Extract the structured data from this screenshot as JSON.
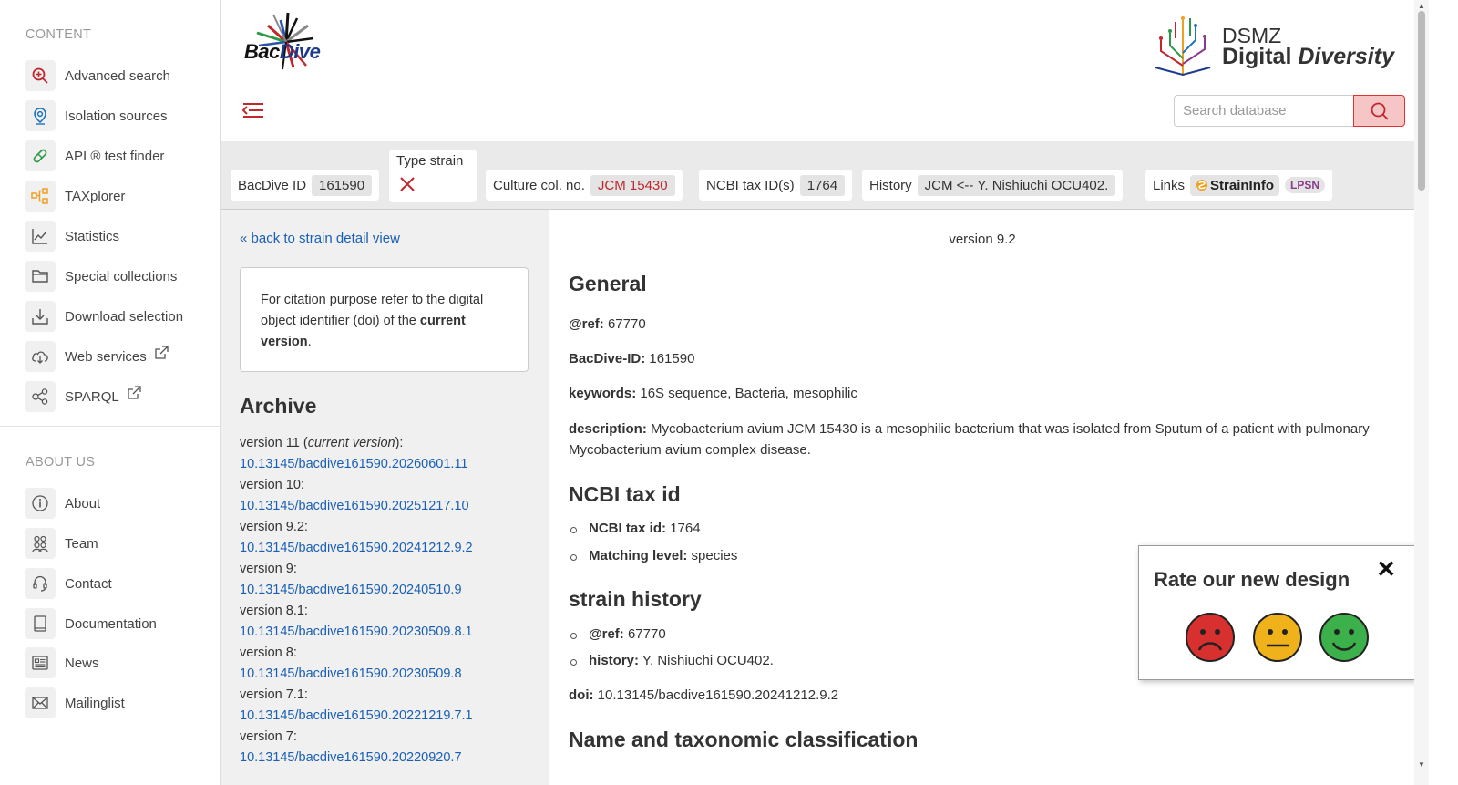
{
  "sidebar": {
    "content_heading": "CONTENT",
    "content_items": [
      {
        "label": "Advanced search",
        "icon": "search-plus-icon"
      },
      {
        "label": "Isolation sources",
        "icon": "location-pin-icon"
      },
      {
        "label": "API ® test finder",
        "icon": "pill-icon"
      },
      {
        "label": "TAXplorer",
        "icon": "tree-icon"
      },
      {
        "label": "Statistics",
        "icon": "chart-line-icon"
      },
      {
        "label": "Special collections",
        "icon": "folder-icon"
      },
      {
        "label": "Download selection",
        "icon": "download-icon"
      },
      {
        "label": "Web services",
        "icon": "cloud-download-icon"
      },
      {
        "label": "SPARQL",
        "icon": "share-nodes-icon"
      }
    ],
    "about_heading": "ABOUT US",
    "about_items": [
      {
        "label": "About",
        "icon": "info-icon"
      },
      {
        "label": "Team",
        "icon": "team-icon"
      },
      {
        "label": "Contact",
        "icon": "headset-icon"
      },
      {
        "label": "Documentation",
        "icon": "book-icon"
      },
      {
        "label": "News",
        "icon": "newspaper-icon"
      },
      {
        "label": "Mailinglist",
        "icon": "envelope-icon"
      }
    ]
  },
  "header": {
    "logo_bac": "Bac",
    "logo_dive": "Dive",
    "dsmz_title": "DSMZ",
    "dsmz_sub_1": "Digital",
    "dsmz_sub_2": "Diversity",
    "search_placeholder": "Search database"
  },
  "infobar": {
    "bacdive_id_label": "BacDive ID",
    "bacdive_id_value": "161590",
    "type_strain_label": "Type strain",
    "culture_label": "Culture col. no.",
    "culture_value": "JCM 15430",
    "ncbi_label": "NCBI tax ID(s)",
    "ncbi_value": "1764",
    "history_label": "History",
    "history_value": "JCM <-- Y. Nishiuchi OCU402.",
    "links_label": "Links",
    "straininfo": "StrainInfo",
    "lpsn": "LPSN"
  },
  "left": {
    "back_link": "« back to strain detail view",
    "cite_1": "For citation purpose refer to the digital object identifier (doi) of the ",
    "cite_bold": "current version",
    "cite_end": ".",
    "archive_title": "Archive",
    "archive": [
      {
        "version": "version 11 (",
        "current": "current version",
        "suffix": "):",
        "doi": "10.13145/bacdive161590.20260601.11"
      },
      {
        "version": "version 10:",
        "doi": "10.13145/bacdive161590.20251217.10"
      },
      {
        "version": "version 9.2:",
        "doi": "10.13145/bacdive161590.20241212.9.2"
      },
      {
        "version": "version 9:",
        "doi": "10.13145/bacdive161590.20240510.9"
      },
      {
        "version": "version 8.1:",
        "doi": "10.13145/bacdive161590.20230509.8.1"
      },
      {
        "version": "version 8:",
        "doi": "10.13145/bacdive161590.20230509.8"
      },
      {
        "version": "version 7.1:",
        "doi": "10.13145/bacdive161590.20221219.7.1"
      },
      {
        "version": "version 7:",
        "doi": "10.13145/bacdive161590.20220920.7"
      }
    ]
  },
  "main": {
    "version": "version 9.2",
    "general_title": "General",
    "ref_label": "@ref:",
    "ref_value": "67770",
    "bacdive_label": "BacDive-ID:",
    "bacdive_value": "161590",
    "keywords_label": "keywords:",
    "keywords_value": "16S sequence, Bacteria, mesophilic",
    "description_label": "description:",
    "description_value": "Mycobacterium avium JCM 15430 is a mesophilic bacterium that was isolated from Sputum of a patient with pulmonary Mycobacterium avium complex disease.",
    "ncbi_title": "NCBI tax id",
    "ncbi_tax_label": "NCBI tax id:",
    "ncbi_tax_value": "1764",
    "matching_label": "Matching level:",
    "matching_value": "species",
    "history_title": "strain history",
    "hist_ref_label": "@ref:",
    "hist_ref_value": "67770",
    "hist_label": "history:",
    "hist_value": "Y. Nishiuchi OCU402.",
    "doi_label": "doi:",
    "doi_value": "10.13145/bacdive161590.20241212.9.2",
    "name_title": "Name and taxonomic classification"
  },
  "rating": {
    "title": "Rate our new design",
    "close": "✕"
  },
  "colors": {
    "accent_red": "#c1272d",
    "link_blue": "#1a5fb4",
    "icon_green": "#2e9a48",
    "icon_blue": "#1e73be",
    "icon_orange": "#f0a020"
  }
}
